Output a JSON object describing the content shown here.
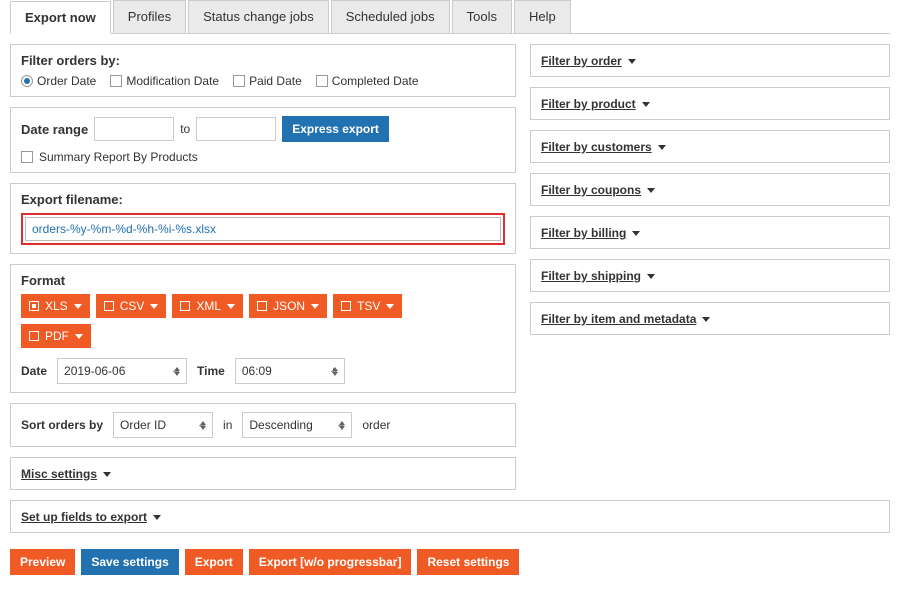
{
  "tabs": {
    "export_now": "Export now",
    "profiles": "Profiles",
    "status_change": "Status change jobs",
    "scheduled": "Scheduled jobs",
    "tools": "Tools",
    "help": "Help"
  },
  "filter_orders": {
    "heading": "Filter orders by:",
    "order_date": "Order Date",
    "modification_date": "Modification Date",
    "paid_date": "Paid Date",
    "completed_date": "Completed Date"
  },
  "date_range": {
    "label": "Date range",
    "to": "to",
    "express_export": "Express export",
    "summary_report": "Summary Report By Products"
  },
  "export_filename": {
    "heading": "Export filename:",
    "value": "orders-%y-%m-%d-%h-%i-%s.xlsx"
  },
  "format": {
    "heading": "Format",
    "xls": "XLS",
    "csv": "CSV",
    "xml": "XML",
    "json": "JSON",
    "tsv": "TSV",
    "pdf": "PDF"
  },
  "datetime": {
    "date_label": "Date",
    "date_value": "2019-06-06",
    "time_label": "Time",
    "time_value": "06:09"
  },
  "sort": {
    "label": "Sort orders by",
    "field": "Order ID",
    "in": "in",
    "direction": "Descending",
    "order": "order"
  },
  "accordions_left": {
    "misc": "Misc settings",
    "fields": "Set up fields to export"
  },
  "filters": {
    "order": "Filter by order",
    "product": "Filter by product",
    "customers": "Filter by customers",
    "coupons": "Filter by coupons",
    "billing": "Filter by billing",
    "shipping": "Filter by shipping",
    "item_meta": "Filter by item and metadata"
  },
  "footer": {
    "preview": "Preview",
    "save_settings": "Save settings",
    "export": "Export",
    "export_wo_progress": "Export [w/o progressbar]",
    "reset": "Reset settings"
  }
}
